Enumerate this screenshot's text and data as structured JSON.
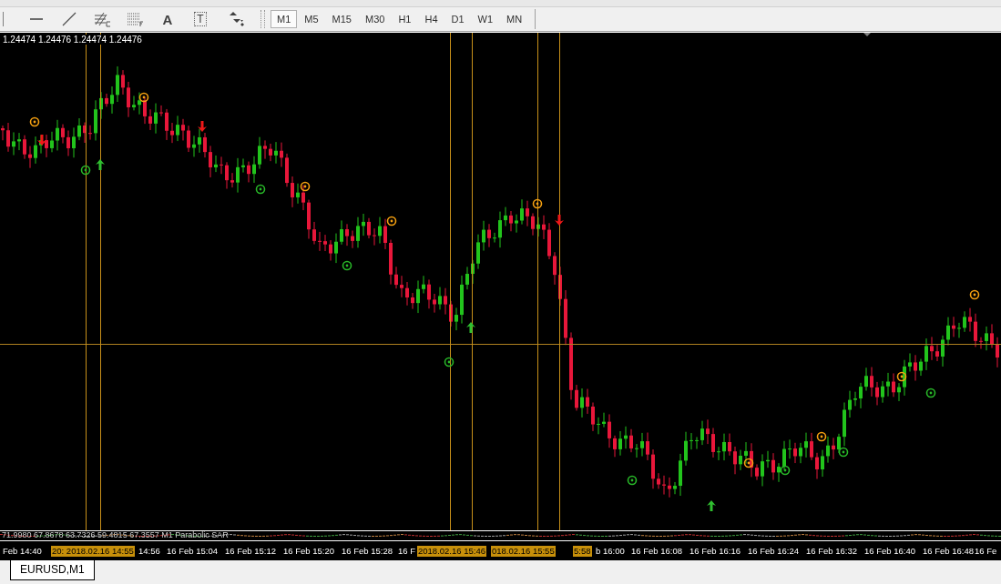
{
  "toolbar": {
    "tools": [
      {
        "kind": "hline"
      },
      {
        "kind": "trendline"
      },
      {
        "kind": "fibo"
      },
      {
        "kind": "grid"
      },
      {
        "kind": "text",
        "label": "A"
      },
      {
        "kind": "label",
        "label": "T"
      },
      {
        "kind": "arrows"
      }
    ],
    "timeframes": [
      {
        "label": "M1",
        "selected": true
      },
      {
        "label": "M5",
        "selected": false
      },
      {
        "label": "M15",
        "selected": false
      },
      {
        "label": "M30",
        "selected": false
      },
      {
        "label": "H1",
        "selected": false
      },
      {
        "label": "H4",
        "selected": false
      },
      {
        "label": "D1",
        "selected": false
      },
      {
        "label": "W1",
        "selected": false
      },
      {
        "label": "MN",
        "selected": false
      }
    ]
  },
  "chart": {
    "ohlc": "1.24474 1.24476 1.24474 1.24476",
    "indicator_text": "71.9980 67.8678 63.7326 59.4815 67.3557 M1 Parabolic SAR",
    "time_axis": [
      {
        "label": "Feb 14:40",
        "highlighted": false
      },
      {
        "label": "20: 2018.02.16 14:55",
        "highlighted": true
      },
      {
        "label": "14:56",
        "highlighted": false
      },
      {
        "label": "16 Feb 15:04",
        "highlighted": false
      },
      {
        "label": "16 Feb 15:12",
        "highlighted": false
      },
      {
        "label": "16 Feb 15:20",
        "highlighted": false
      },
      {
        "label": "16 Feb 15:28",
        "highlighted": false
      },
      {
        "label": "16 F",
        "highlighted": false
      },
      {
        "label": "2018.02.16 15:46",
        "highlighted": true
      },
      {
        "label": "018.02.16 15:55",
        "highlighted": true
      },
      {
        "label": "5:58",
        "highlighted": true
      },
      {
        "label": "b 16:00",
        "highlighted": false
      },
      {
        "label": "16 Feb 16:08",
        "highlighted": false
      },
      {
        "label": "16 Feb 16:16",
        "highlighted": false
      },
      {
        "label": "16 Feb 16:24",
        "highlighted": false
      },
      {
        "label": "16 Feb 16:32",
        "highlighted": false
      },
      {
        "label": "16 Feb 16:40",
        "highlighted": false
      },
      {
        "label": "16 Feb 16:48",
        "highlighted": false
      },
      {
        "label": "16 Fe",
        "highlighted": false
      }
    ]
  },
  "tabs": [
    {
      "label": "EURUSD,M1",
      "selected": true
    }
  ]
}
